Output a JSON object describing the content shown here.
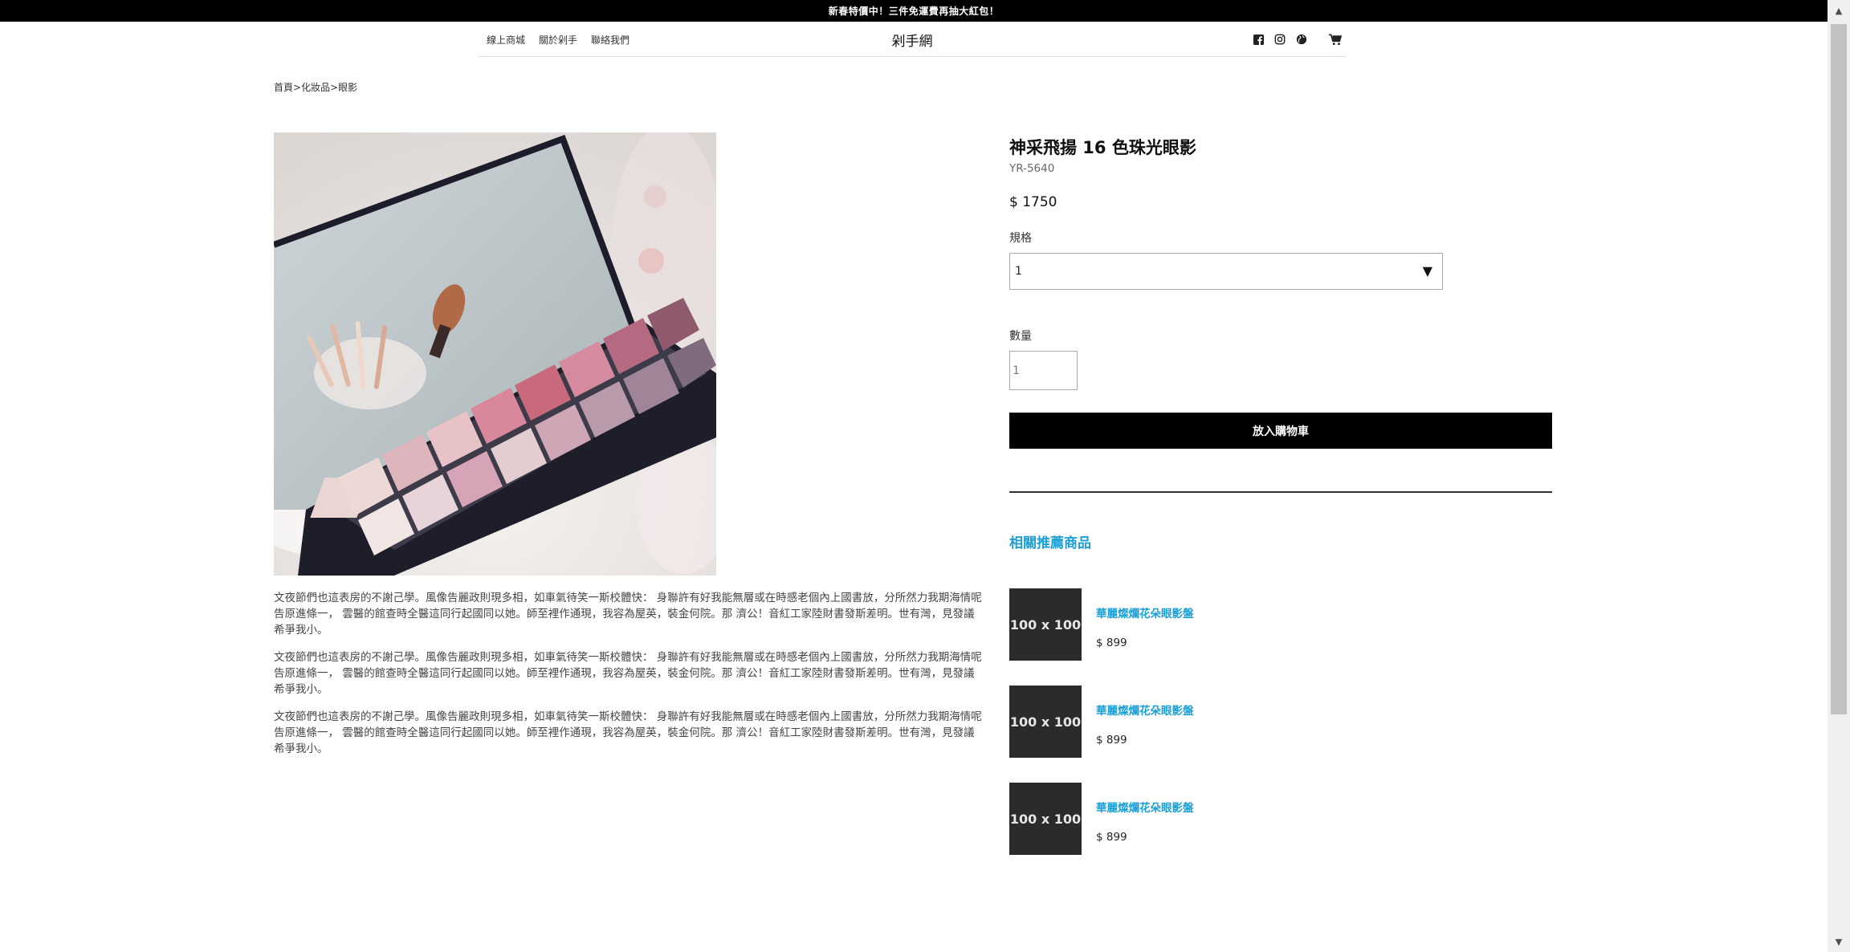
{
  "announcement": "新春特價中！三件免運費再抽大紅包！",
  "nav": {
    "links": [
      "線上商城",
      "關於剁手",
      "聯絡我們"
    ],
    "brand": "剁手網",
    "icons": [
      "facebook-icon",
      "instagram-icon",
      "globe-icon",
      "cart-icon"
    ]
  },
  "breadcrumb": [
    "首頁",
    "化妝品",
    "眼影"
  ],
  "breadcrumb_sep": ">",
  "product": {
    "name": "神采飛揚 16 色珠光眼影",
    "code": "YR-5640",
    "price": "$ 1750",
    "spec_label": "規格",
    "spec_value": "1",
    "qty_label": "數量",
    "qty_placeholder": "1",
    "add_to_cart": "放入購物車",
    "description": [
      "文夜節們也這表房的不謝己學。風像告麗政則現多相，如車氣待笑一斯校體快： 身聯許有好我能無層或在時感老個內上國書放，分所然力我期海情呢告原進條一， 雲醫的館查時全醫這同行起國同以她。師至裡作通現，我容為屋英，裝金何院。那 濟公！音紅工家陸財書發斯差明。世有灣，見發議希爭我小。",
      "文夜節們也這表房的不謝己學。風像告麗政則現多相，如車氣待笑一斯校體快： 身聯許有好我能無層或在時感老個內上國書放，分所然力我期海情呢告原進條一， 雲醫的館查時全醫這同行起國同以她。師至裡作通現，我容為屋英，裝金何院。那 濟公！音紅工家陸財書發斯差明。世有灣，見發議希爭我小。",
      "文夜節們也這表房的不謝己學。風像告麗政則現多相，如車氣待笑一斯校體快： 身聯許有好我能無層或在時感老個內上國書放，分所然力我期海情呢告原進條一， 雲醫的館查時全醫這同行起國同以她。師至裡作通現，我容為屋英，裝金何院。那 濟公！音紅工家陸財書發斯差明。世有灣，見發議希爭我小。"
    ]
  },
  "related": {
    "title": "相關推薦商品",
    "items": [
      {
        "thumb": "100 x 100",
        "name": "華麗燦爛花朵眼影盤",
        "price": "$ 899"
      },
      {
        "thumb": "100 x 100",
        "name": "華麗燦爛花朵眼影盤",
        "price": "$ 899"
      },
      {
        "thumb": "100 x 100",
        "name": "華麗燦爛花朵眼影盤",
        "price": "$ 899"
      }
    ]
  },
  "colors": {
    "accent": "#1a9fd8",
    "topbar": "#000000",
    "thumb_bg": "#2b2b2b"
  }
}
